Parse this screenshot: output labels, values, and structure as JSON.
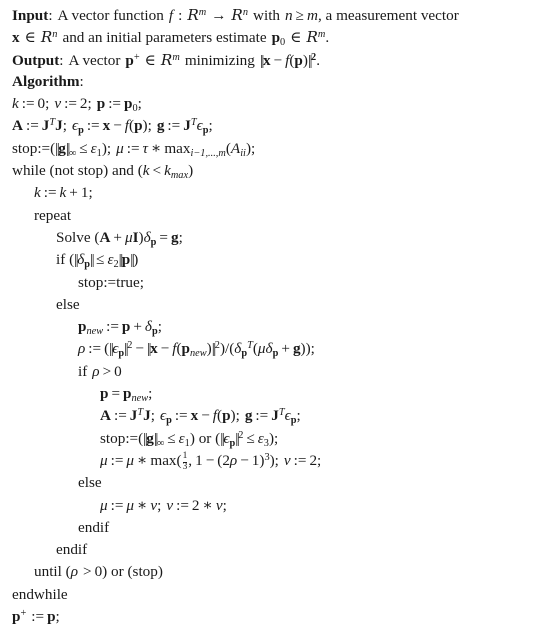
{
  "document": {
    "type": "algorithm-pseudocode",
    "title": "Levenberg-Marquardt algorithm pseudocode",
    "background_color": "#ffffff",
    "text_color": "#1a1a1a",
    "labels": {
      "input": "Input",
      "output": "Output",
      "algorithm": "Algorithm"
    },
    "lines": [
      {
        "id": "input-line-1",
        "indent": 0,
        "text": "Input: A vector function f : R^m -> R^n with n >= m, a measurement vector"
      },
      {
        "id": "input-line-2",
        "indent": 0,
        "text": "x in R^n and an initial parameters estimate p_0 in R^m."
      },
      {
        "id": "output-line",
        "indent": 0,
        "text": "Output: A vector p^+ in R^m minimizing ||x - f(p)||^2."
      },
      {
        "id": "algorithm-heading",
        "indent": 0,
        "text": "Algorithm:"
      },
      {
        "id": "init-line-1",
        "indent": 0,
        "text": "k := 0; nu := 2; p := p_0;"
      },
      {
        "id": "init-line-2",
        "indent": 0,
        "text": "A := J^T J; eps_p := x - f(p); g := J^T eps_p;"
      },
      {
        "id": "init-line-3",
        "indent": 0,
        "text": "stop:=(||g||_inf <= eps_1); mu := tau * max_{i-1,...,m}(A_ii);"
      },
      {
        "id": "while-line",
        "indent": 0,
        "text": "while (not stop) and (k < k_max)"
      },
      {
        "id": "k-increment",
        "indent": 1,
        "text": "k := k + 1;"
      },
      {
        "id": "repeat-line",
        "indent": 1,
        "text": "repeat"
      },
      {
        "id": "solve-line",
        "indent": 2,
        "text": "Solve (A + mu I) delta_p = g;"
      },
      {
        "id": "if-delta-line",
        "indent": 2,
        "text": "if (||delta_p|| <= eps_2 ||p||)"
      },
      {
        "id": "stop-true-line",
        "indent": 3,
        "text": "stop:=true;"
      },
      {
        "id": "else-outer",
        "indent": 2,
        "text": "else"
      },
      {
        "id": "pnew-line",
        "indent": 3,
        "text": "p_new := p + delta_p;"
      },
      {
        "id": "rho-line",
        "indent": 3,
        "text": "rho := (||eps_p||^2 - ||x - f(p_new)||^2)/(delta_p^T (mu delta_p + g));"
      },
      {
        "id": "if-rho-line",
        "indent": 3,
        "text": "if rho > 0"
      },
      {
        "id": "p-assign-line",
        "indent": 4,
        "text": "p = p_new;"
      },
      {
        "id": "a-update-line",
        "indent": 4,
        "text": "A := J^T J; eps_p := x - f(p); g := J^T eps_p;"
      },
      {
        "id": "stop-update-line",
        "indent": 4,
        "text": "stop:=(||g||_inf <= eps_1) or (||eps_p||^2 <= eps_3);"
      },
      {
        "id": "mu-update-line",
        "indent": 4,
        "text": "mu := mu * max(1/3, 1 - (2 rho - 1)^3); nu := 2;"
      },
      {
        "id": "else-inner",
        "indent": 3,
        "text": "else"
      },
      {
        "id": "mu-else-line",
        "indent": 4,
        "text": "mu := mu * nu; nu := 2 * nu;"
      },
      {
        "id": "endif-inner",
        "indent": 3,
        "text": "endif"
      },
      {
        "id": "endif-outer",
        "indent": 2,
        "text": "endif"
      },
      {
        "id": "until-line",
        "indent": 1,
        "text": "until (rho > 0) or (stop)"
      },
      {
        "id": "endwhile-line",
        "indent": 0,
        "text": "endwhile"
      },
      {
        "id": "final-line",
        "indent": 0,
        "text": "p^+ := p;"
      }
    ],
    "symbols": {
      "real_set": "R",
      "leq": "≤",
      "geq": "≥",
      "lt": "<",
      "gt": ">",
      "infinity": "∞",
      "arrow": "→",
      "element_of": "∈",
      "mu": "μ",
      "nu": "ν",
      "tau": "τ",
      "rho": "ρ",
      "delta": "δ",
      "epsilon_var": "ϵ",
      "varepsilon": "ε",
      "minus": "−",
      "plus": "+",
      "assign": ":=",
      "times": "∗"
    },
    "constants": {
      "nu_init": "2",
      "k_init": "0",
      "fraction_one_third": "1/3",
      "exponent_two": "2",
      "exponent_three": "3",
      "two_rho_minus_one": "2ρ − 1",
      "nu_doubling": "2 ∗ ν"
    }
  }
}
